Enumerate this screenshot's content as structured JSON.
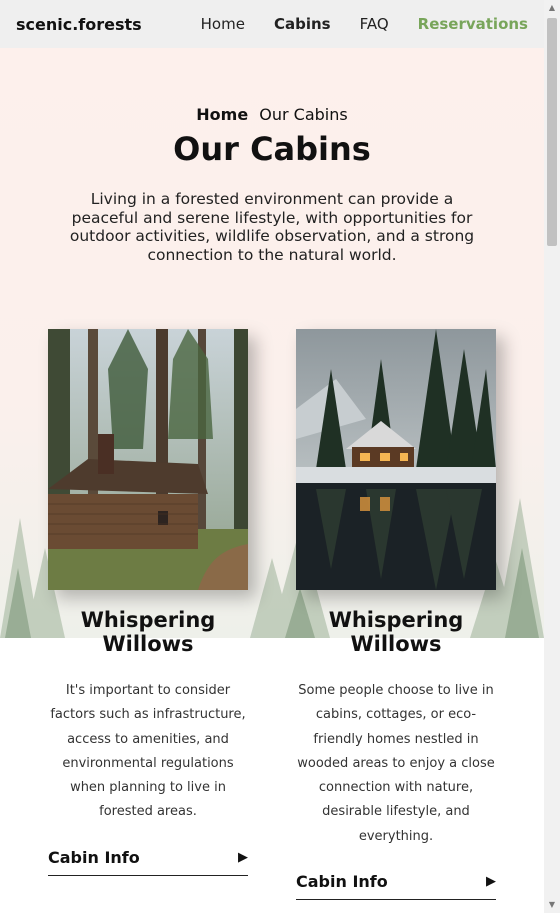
{
  "nav": {
    "logo": "scenic.forests",
    "links": [
      "Home",
      "Cabins",
      "FAQ",
      "Reservations"
    ]
  },
  "hero": {
    "breadcrumb_home": "Home",
    "breadcrumb_current": "Our Cabins",
    "title": "Our Cabins",
    "intro": "Living in a forested environment can provide a peaceful and serene lifestyle, with opportunities for outdoor activities, wildlife observation, and a strong connection to the natural world."
  },
  "cabins": [
    {
      "title": "Whispering Willows",
      "description": "It's important to consider factors such as infrastructure, access to amenities, and environmental regulations when planning to live in forested areas.",
      "link": "Cabin Info"
    },
    {
      "title": "Whispering Willows",
      "description": "Some people choose to live in cabins, cottages, or eco-friendly homes nestled in wooded areas to enjoy a close connection with nature, desirable lifestyle, and everything.",
      "link": "Cabin Info"
    }
  ],
  "colors": {
    "accent_green": "#78a55a",
    "hero_background": "#fdf0ec",
    "navbar_background": "#efefef"
  },
  "icons": {
    "link_arrow": "play-arrow-icon",
    "scroll_up": "arrow-up-icon",
    "scroll_down": "arrow-down-icon"
  }
}
